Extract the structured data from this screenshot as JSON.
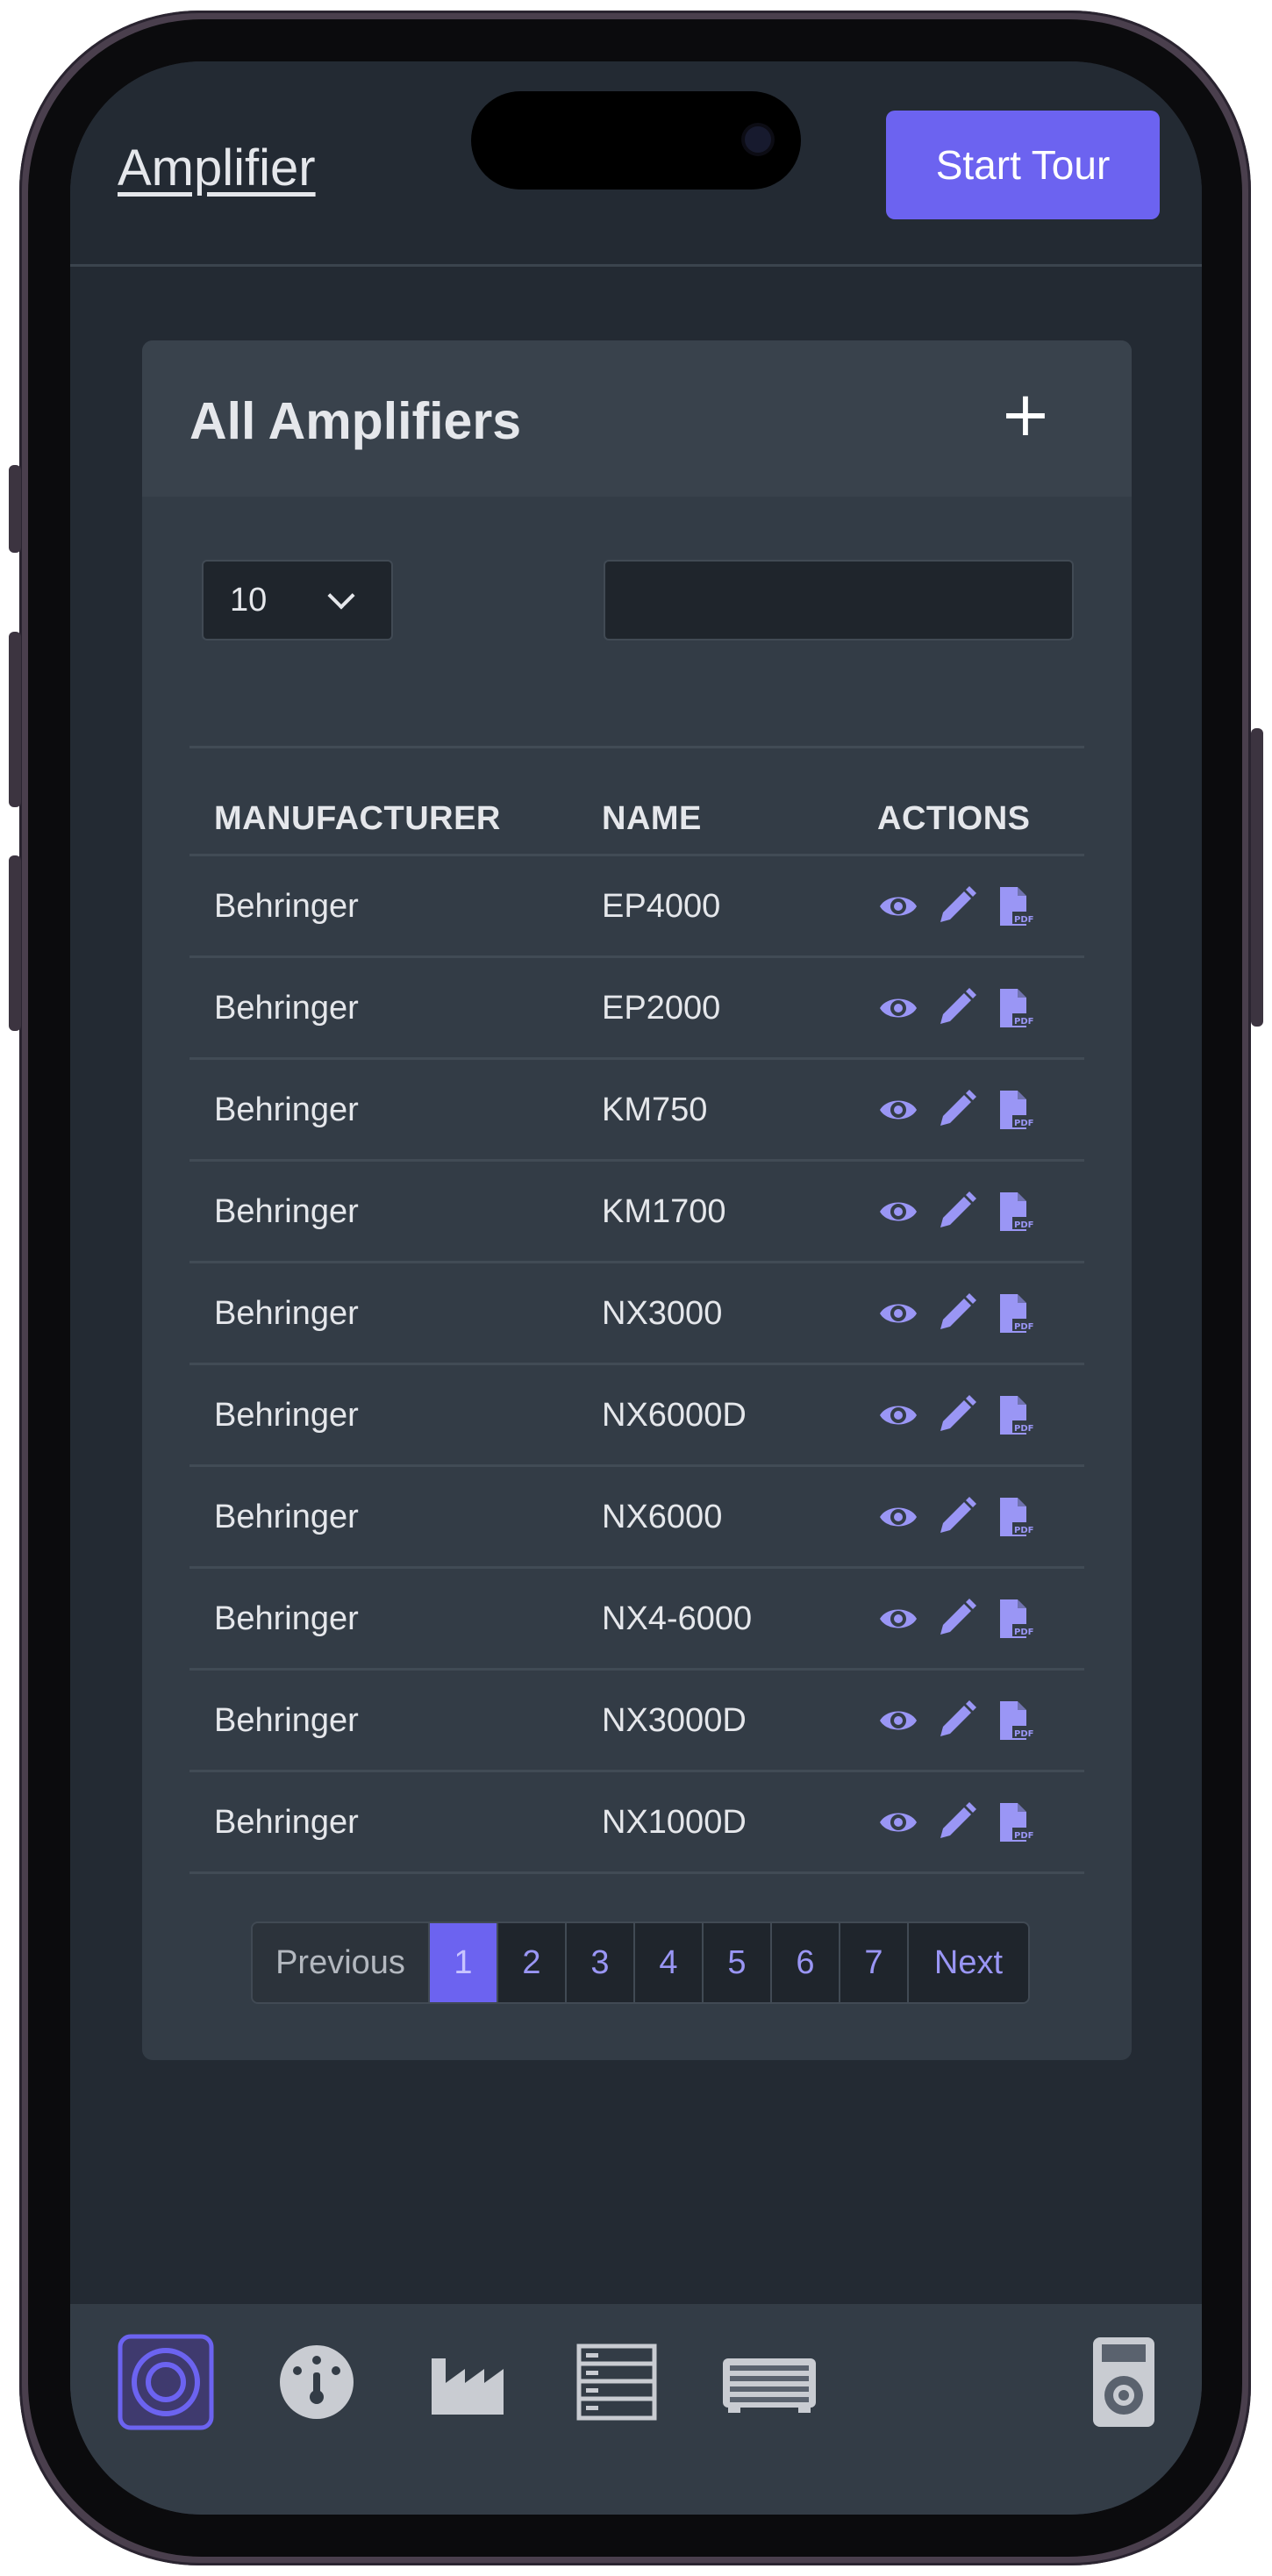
{
  "header": {
    "brand": "Amplifier",
    "start_tour_label": "Start Tour"
  },
  "card": {
    "title": "All Amplifiers",
    "add_icon": "plus-icon"
  },
  "controls": {
    "page_size": "10",
    "search_value": ""
  },
  "table": {
    "headers": [
      "MANUFACTURER",
      "NAME",
      "ACTIONS"
    ],
    "rows": [
      {
        "manufacturer": "Behringer",
        "name": "EP4000"
      },
      {
        "manufacturer": "Behringer",
        "name": "EP2000"
      },
      {
        "manufacturer": "Behringer",
        "name": "KM750"
      },
      {
        "manufacturer": "Behringer",
        "name": "KM1700"
      },
      {
        "manufacturer": "Behringer",
        "name": "NX3000"
      },
      {
        "manufacturer": "Behringer",
        "name": "NX6000D"
      },
      {
        "manufacturer": "Behringer",
        "name": "NX6000"
      },
      {
        "manufacturer": "Behringer",
        "name": "NX4-6000"
      },
      {
        "manufacturer": "Behringer",
        "name": "NX3000D"
      },
      {
        "manufacturer": "Behringer",
        "name": "NX1000D"
      }
    ],
    "row_actions": [
      "view-eye-icon",
      "edit-pencil-icon",
      "pdf-file-icon"
    ]
  },
  "pagination": {
    "previous": "Previous",
    "pages": [
      "1",
      "2",
      "3",
      "4",
      "5",
      "6",
      "7"
    ],
    "current": "1",
    "next": "Next"
  },
  "bottom_nav": {
    "items": [
      "speaker-icon",
      "gauge-icon",
      "factory-icon",
      "rack-icon",
      "amplifier-head-icon",
      "speaker-cabinet-icon"
    ],
    "active": "speaker-icon"
  },
  "colors": {
    "accent": "#6c63f0",
    "background": "#232a33",
    "card": "#333c46",
    "icon": "#9a96f5"
  }
}
